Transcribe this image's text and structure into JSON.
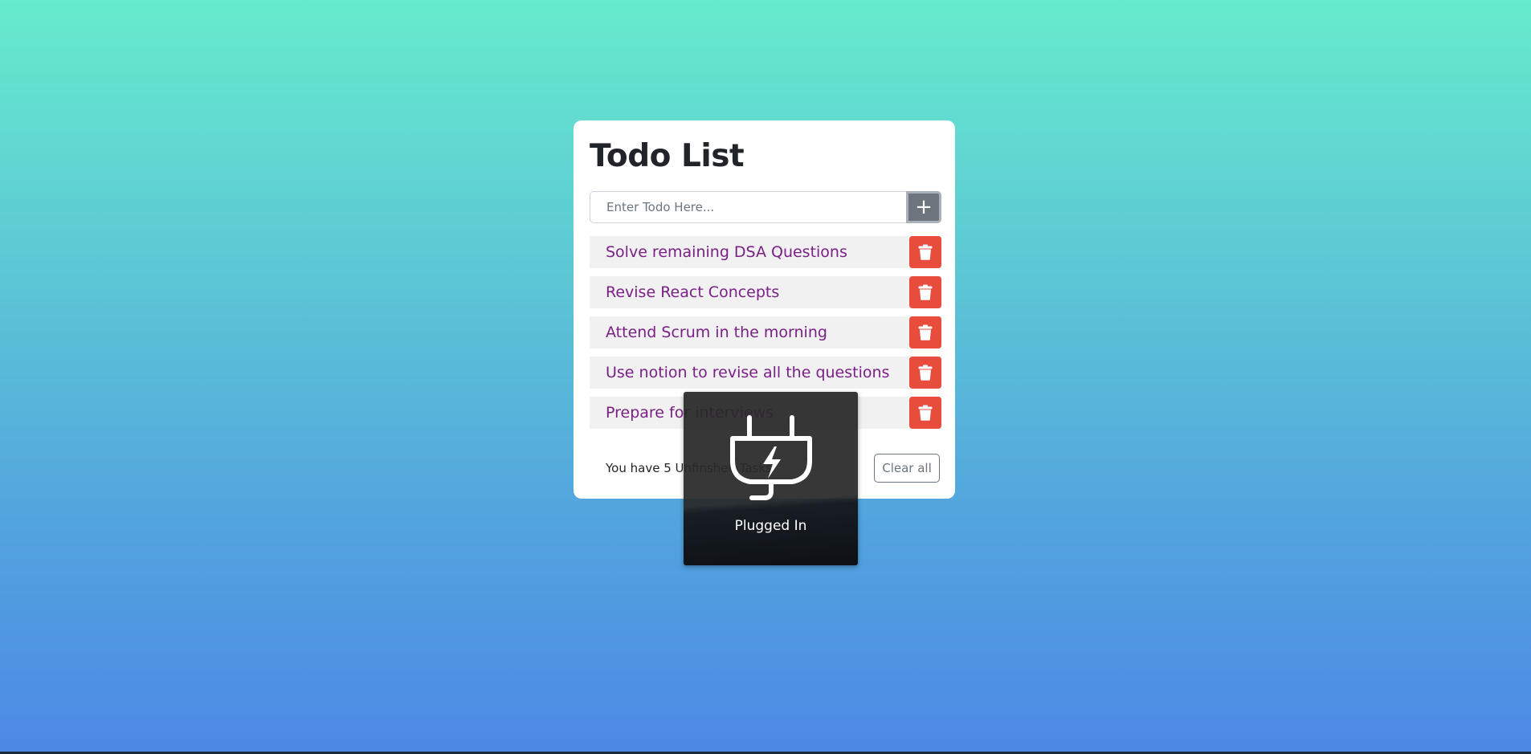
{
  "app": {
    "title": "Todo List",
    "input": {
      "placeholder": "Enter Todo Here...",
      "value": ""
    },
    "add_button": {
      "label": "+"
    },
    "todos": [
      {
        "text": "Solve remaining DSA Questions"
      },
      {
        "text": "Revise React Concepts"
      },
      {
        "text": "Attend Scrum in the morning"
      },
      {
        "text": "Use notion to revise all the questions"
      },
      {
        "text": "Prepare for interviews"
      }
    ],
    "footer": {
      "status_text": "You have 5 Unfinshed Tasks",
      "clear_label": "Clear all"
    }
  },
  "osd": {
    "label": "Plugged In",
    "icon": "plug-charging-icon"
  },
  "colors": {
    "background_top": "#66ebcc",
    "background_bottom": "#4d89e6",
    "todo_text": "#7a1f86",
    "delete_button": "#e74c3c",
    "add_button": "#6c757d"
  }
}
